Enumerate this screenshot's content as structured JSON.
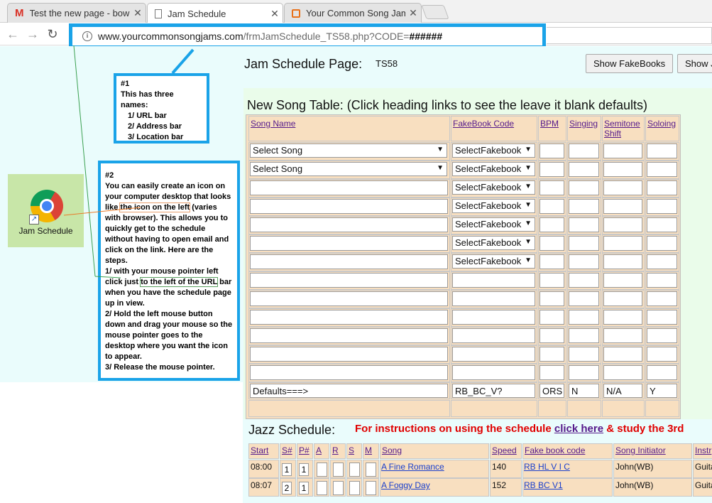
{
  "tabs": [
    {
      "title": "Test the new page - bow",
      "icon": "gmail-icon",
      "color": "#d93025"
    },
    {
      "title": "Jam Schedule",
      "icon": "page-icon",
      "color": "#777777"
    },
    {
      "title": "Your Common Song Jam",
      "icon": "site-icon",
      "color": "#e8711a"
    }
  ],
  "url": {
    "host": "www.yourcommonsongjams.com",
    "path": "/frmJamSchedule_TS58.php?CODE=",
    "code": "######"
  },
  "callout1": {
    "lines": [
      "#1",
      "This has three names:",
      "1/ URL bar",
      "2/ Address bar",
      "3/ Location bar"
    ]
  },
  "callout2": {
    "heading": "#2",
    "p1a": "You can easily create an icon on your computer desktop that looks like ",
    "p1hl": "the icon on the left",
    "p1b": " (varies with browser). This allows you to quickly get to the schedule without having to open email and click on the link. Here are the steps.",
    "s1a": "1/ with your mouse pointer left click just ",
    "s1hl": "to the left of the URL",
    "s1b": " bar when you have the schedule page up in view.",
    "s2": "2/ Hold the left mouse button down and drag your mouse so the mouse pointer goes to the desktop where you want the icon to appear.",
    "s3": "3/ Release the mouse pointer."
  },
  "shortcut": {
    "label": "Jam Schedule"
  },
  "page": {
    "title": "Jam Schedule Page:",
    "code": "TS58",
    "btn_fakebooks": "Show FakeBooks",
    "btn_show2": "Show J"
  },
  "song_table": {
    "heading": "New Song Table: (Click heading links to see the leave it blank defaults)",
    "headers": [
      "Song Name",
      "FakeBook Code",
      "BPM",
      "Singing",
      "Semitone Shift",
      "Soloing"
    ],
    "select_song": "Select Song",
    "select_fakebook": "SelectFakebook",
    "defaults": [
      "Defaults===>",
      "RB_BC_V?",
      "ORS",
      "N",
      "N/A",
      "Y"
    ]
  },
  "jazz": {
    "heading": "Jazz Schedule:",
    "info_a": "For instructions on using the schedule ",
    "info_link": "click here",
    "info_b": " & study the 3rd",
    "headers": [
      "Start",
      "S#",
      "P#",
      "A",
      "R",
      "S",
      "M",
      "Song",
      "Speed",
      "Fake book code",
      "Song Initiator",
      "Instr"
    ],
    "rows": [
      {
        "start": "08:00",
        "s": "1",
        "p": "1",
        "song": "A Fine Romance",
        "speed": "140",
        "code": "RB HL V I C",
        "init": "John(WB)",
        "instr": "Guita"
      },
      {
        "start": "08:07",
        "s": "2",
        "p": "1",
        "song": "A Foggy Day",
        "speed": "152",
        "code": "RB BC V1",
        "init": "John(WB)",
        "instr": "Guita"
      }
    ]
  }
}
